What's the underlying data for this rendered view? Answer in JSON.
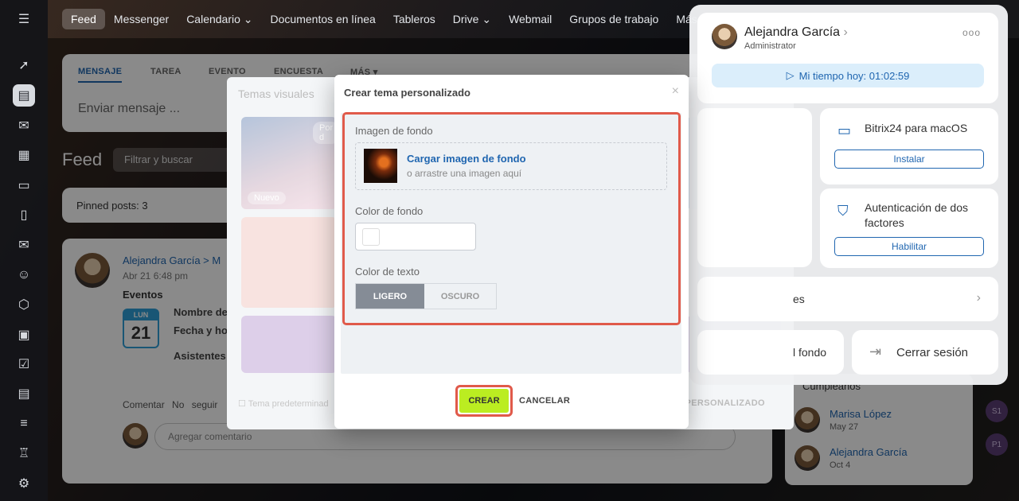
{
  "nav": {
    "items": [
      "Feed",
      "Messenger",
      "Calendario ⌄",
      "Documentos en línea",
      "Tableros",
      "Drive ⌄",
      "Webmail",
      "Grupos de trabajo",
      "Más ⌄"
    ]
  },
  "rail": {
    "icons": [
      "menu-icon",
      "rocket-icon",
      "feed-icon",
      "chat-icon",
      "calendar-icon",
      "inbox-icon",
      "document-icon",
      "mail-icon",
      "group-icon",
      "hexagon-icon",
      "presentation-icon",
      "task-icon",
      "card-icon",
      "filter-icon",
      "robot-icon",
      "settings-icon"
    ]
  },
  "composer": {
    "tabs": [
      "MENSAJE",
      "TAREA",
      "EVENTO",
      "ENCUESTA",
      "MÁS ▾"
    ],
    "placeholder": "Enviar mensaje ..."
  },
  "feed": {
    "title": "Feed",
    "search_placeholder": "Filtrar y buscar",
    "pinned": "Pinned posts: 3"
  },
  "post": {
    "author": "Alejandra García  >  M",
    "date": "Abr 21 6:48 pm",
    "type": "Eventos",
    "cal_month": "LUN",
    "cal_day": "21",
    "event_name": "Nombre de",
    "event_date": "Fecha y hor",
    "event_attendees": "Asistentes",
    "actions": "Comentar No seguir",
    "comment_placeholder": "Agregar comentario"
  },
  "birthdays": {
    "title": "Cumpleaños",
    "people": [
      {
        "name": "Marisa López",
        "date": "May 27"
      },
      {
        "name": "Alejandra García",
        "date": "Oct 4"
      }
    ]
  },
  "right_dots": [
    "S1",
    "P1"
  ],
  "temas": {
    "title": "Temas visuales",
    "badge_new": "Nuevo",
    "badge_default": "Por d",
    "default_checkbox": "Tema predeterminad",
    "personal_btn": "PERSONALIZADO"
  },
  "dialog": {
    "title": "Crear tema personalizado",
    "bg_image_label": "Imagen de fondo",
    "upload_link": "Cargar imagen de fondo",
    "upload_hint": "o arrastre una imagen aquí",
    "bg_color_label": "Color de fondo",
    "text_color_label": "Color de texto",
    "light": "LIGERO",
    "dark": "OSCURO",
    "create": "CREAR",
    "cancel": "CANCELAR"
  },
  "profile": {
    "name": "Alejandra García",
    "role": "Administrator",
    "timer": "Mi tiempo hoy: 01:02:59",
    "mac_title": "Bitrix24 para macOS",
    "mac_btn": "Instalar",
    "twofa_title": "Autenticación de dos factores",
    "twofa_btn": "Habilitar",
    "row_partial": "es",
    "bg_partial": "l fondo",
    "logout": "Cerrar sesión"
  },
  "colors": {
    "accent": "#2066b0",
    "create_button": "#bbed21",
    "highlight": "#e05a4a"
  }
}
